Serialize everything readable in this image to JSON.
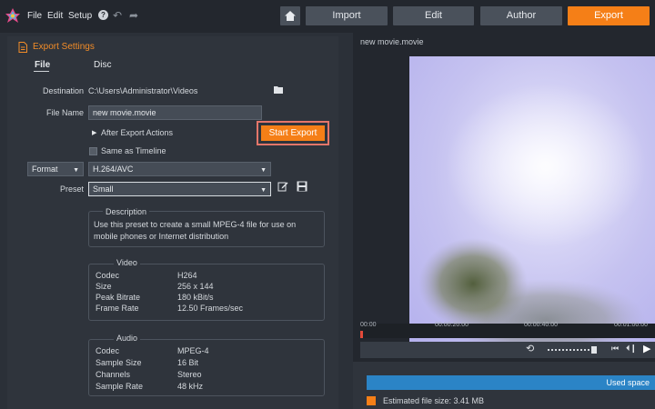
{
  "menu": {
    "file": "File",
    "edit": "Edit",
    "setup": "Setup",
    "help_icon": "?",
    "undo_icon": "undo-icon",
    "redo_icon": "redo-icon"
  },
  "nav": {
    "home_icon": "home-icon",
    "import": "Import",
    "edit": "Edit",
    "author": "Author",
    "export": "Export",
    "active": "Export"
  },
  "export_settings": {
    "title": "Export Settings",
    "tabs": {
      "file": "File",
      "disc": "Disc"
    },
    "destination_label": "Destination",
    "destination_value": "C:\\Users\\Administrator\\Videos",
    "folder_icon": "folder-icon",
    "filename_label": "File Name",
    "filename_value": "new movie.movie",
    "after_actions": "After Export Actions",
    "start_export": "Start Export",
    "same_as_timeline": "Same as Timeline",
    "format_label": "Format",
    "format_value": "H.264/AVC",
    "preset_label": "Preset",
    "preset_value": "Small",
    "edit_icon": "edit-icon",
    "save_icon": "save-icon"
  },
  "description": {
    "title": "Description",
    "line1": "Use this preset to create a small MPEG-4 file for use on",
    "line2": "mobile phones or Internet distribution"
  },
  "video": {
    "title": "Video",
    "rows": [
      {
        "key": "Codec",
        "value": "H264"
      },
      {
        "key": "Size",
        "value": "256 x 144"
      },
      {
        "key": "Peak Bitrate",
        "value": "180 kBit/s"
      },
      {
        "key": "Frame Rate",
        "value": "12.50 Frames/sec"
      }
    ]
  },
  "audio": {
    "title": "Audio",
    "rows": [
      {
        "key": "Codec",
        "value": "MPEG-4"
      },
      {
        "key": "Sample Size",
        "value": "16 Bit"
      },
      {
        "key": "Channels",
        "value": "Stereo"
      },
      {
        "key": "Sample Rate",
        "value": "48 kHz"
      }
    ]
  },
  "preview": {
    "title": "new movie.movie",
    "timeline_labels": [
      "00:00",
      "00:00:20.00",
      "00:00:40.00",
      "00:01:00.00"
    ],
    "used_space": "Used space",
    "estimated_size": "Estimated file size: 3.41 MB"
  },
  "colors": {
    "accent": "#f57f17",
    "highlight_border": "#e4766a",
    "used_space_bar": "#2b84c6"
  }
}
